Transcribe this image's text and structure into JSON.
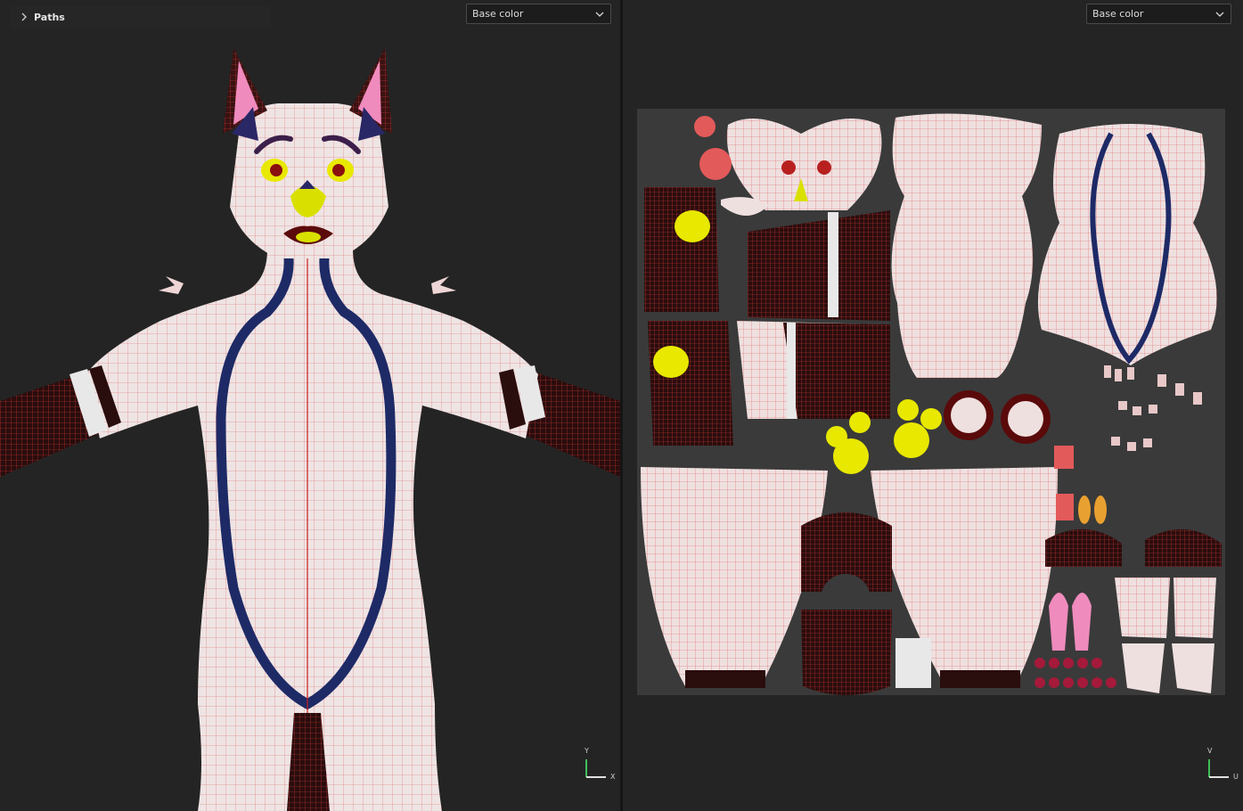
{
  "left_viewport": {
    "panel_label": "Paths",
    "channel_select": "Base color",
    "axis_labels": {
      "vertical": "Y",
      "horizontal": "X"
    }
  },
  "right_viewport": {
    "channel_select": "Base color",
    "axis_labels": {
      "vertical": "V",
      "horizontal": "U"
    }
  },
  "colors": {
    "fur_white": "#ecdcdc",
    "wire_red": "#d63a3a",
    "stripe_navy": "#1e2a66",
    "nose_yellow": "#d9e000",
    "ear_pink": "#f08bbd",
    "uv_background": "#3a3a3a"
  },
  "icons": {
    "paths_toggle": "chevron-right-icon",
    "select_arrow": "chevron-down-icon",
    "axis_gizmo": "axis-gizmo-icon"
  }
}
